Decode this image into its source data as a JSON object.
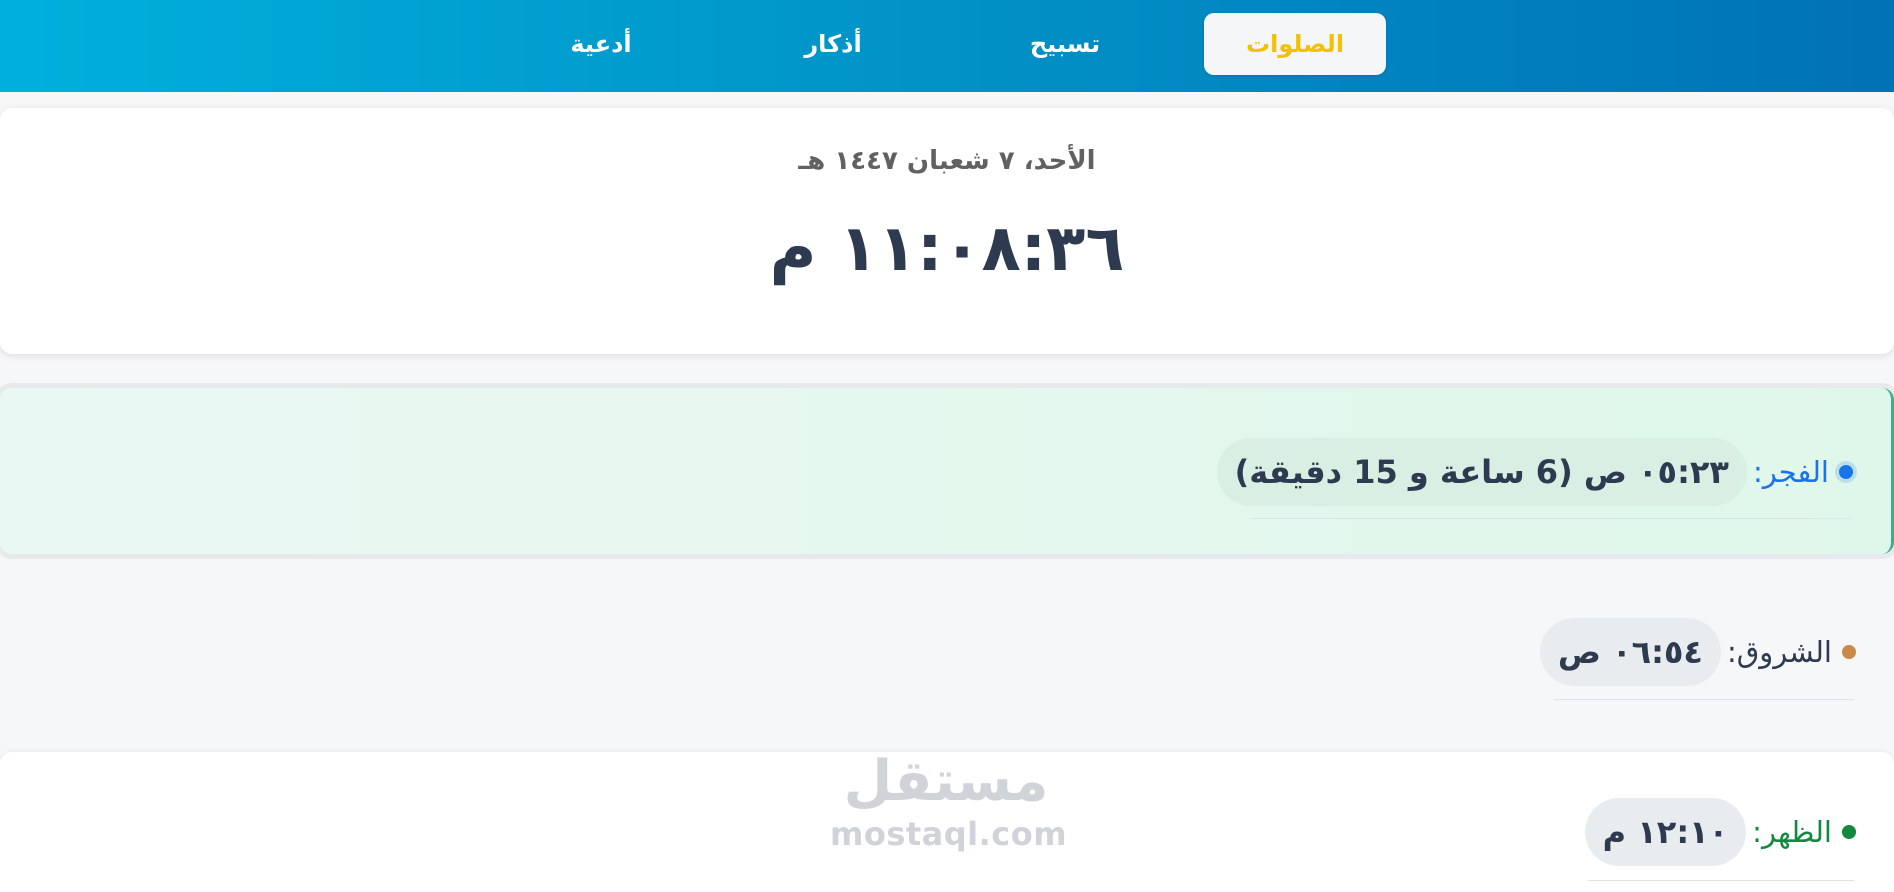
{
  "nav": {
    "tabs": [
      {
        "label": "الصلوات",
        "active": true
      },
      {
        "label": "تسبيح",
        "active": false
      },
      {
        "label": "أذكار",
        "active": false
      },
      {
        "label": "أدعية",
        "active": false
      }
    ],
    "active_color": "#f2c200"
  },
  "header": {
    "hijri_date": "الأحد، ٧ شعبان ١٤٤٧ هـ",
    "clock": "١١:٠٨:٣٦ م"
  },
  "prayers": [
    {
      "name": "الفجر:",
      "time": "٠٥:٢٣ ص (6 ساعة و 15 دقيقة)",
      "color": "#1a73e8",
      "highlighted": true
    },
    {
      "name": "الشروق:",
      "time": "٠٦:٥٤ ص",
      "color": "#c8894a",
      "highlighted": false
    },
    {
      "name": "الظهر:",
      "time": "١٢:١٠ م",
      "color": "#12893f",
      "highlighted": false
    }
  ],
  "watermark": {
    "arabic": "مستقل",
    "latin": "mostaql.com"
  }
}
